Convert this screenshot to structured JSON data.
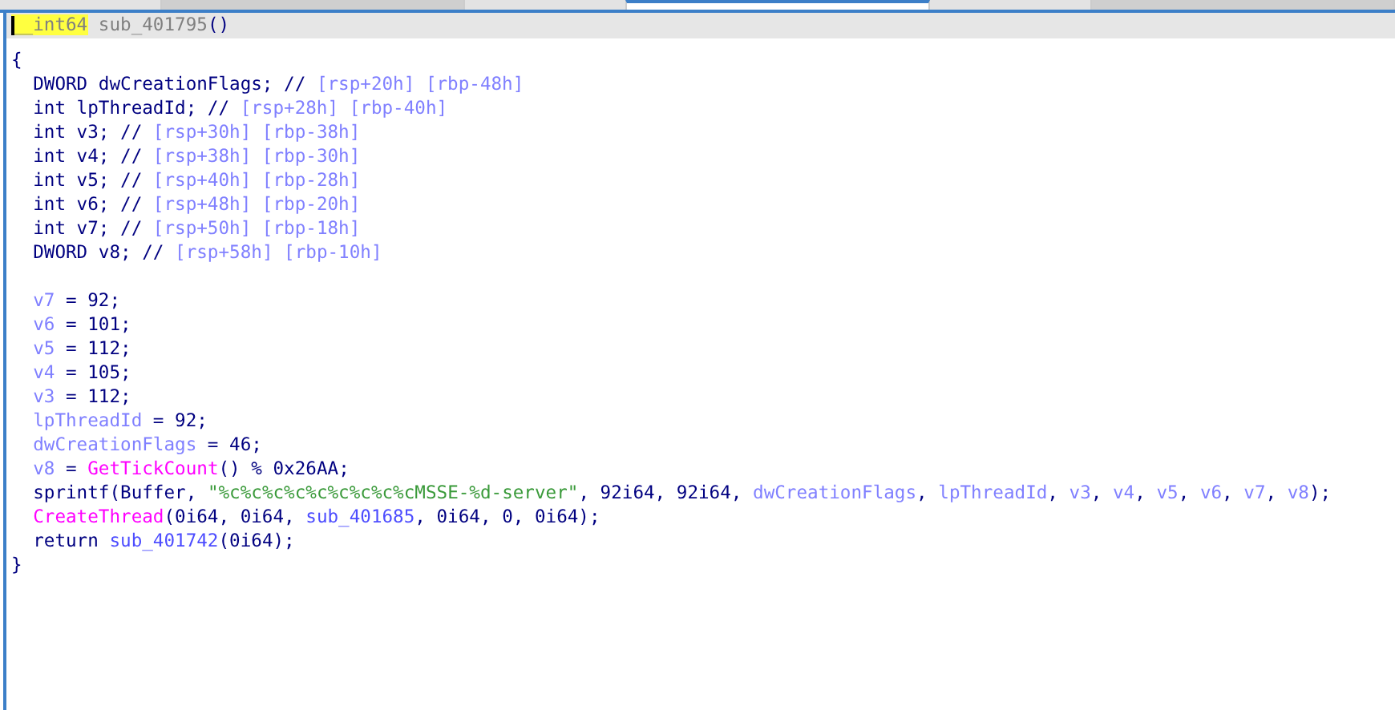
{
  "tabs": [
    {
      "selected": false
    },
    {
      "selected": true
    },
    {
      "selected": false
    }
  ],
  "lines": [
    {
      "current": true,
      "tokens": [
        {
          "text": "__int64",
          "kind": "hl"
        },
        {
          "text": " sub_401795",
          "kind": "name"
        },
        {
          "text": "()",
          "kind": "plain"
        }
      ]
    },
    {
      "current": false,
      "tokens": [
        {
          "text": "{",
          "kind": "plain"
        }
      ]
    },
    {
      "current": false,
      "tokens": [
        {
          "text": "  DWORD dwCreationFlags; // ",
          "kind": "plain"
        },
        {
          "text": "[rsp+20h] [rbp-48h]",
          "kind": "var"
        }
      ]
    },
    {
      "current": false,
      "tokens": [
        {
          "text": "  int lpThreadId; // ",
          "kind": "plain"
        },
        {
          "text": "[rsp+28h] [rbp-40h]",
          "kind": "var"
        }
      ]
    },
    {
      "current": false,
      "tokens": [
        {
          "text": "  int v3; // ",
          "kind": "plain"
        },
        {
          "text": "[rsp+30h] [rbp-38h]",
          "kind": "var"
        }
      ]
    },
    {
      "current": false,
      "tokens": [
        {
          "text": "  int v4; // ",
          "kind": "plain"
        },
        {
          "text": "[rsp+38h] [rbp-30h]",
          "kind": "var"
        }
      ]
    },
    {
      "current": false,
      "tokens": [
        {
          "text": "  int v5; // ",
          "kind": "plain"
        },
        {
          "text": "[rsp+40h] [rbp-28h]",
          "kind": "var"
        }
      ]
    },
    {
      "current": false,
      "tokens": [
        {
          "text": "  int v6; // ",
          "kind": "plain"
        },
        {
          "text": "[rsp+48h] [rbp-20h]",
          "kind": "var"
        }
      ]
    },
    {
      "current": false,
      "tokens": [
        {
          "text": "  int v7; // ",
          "kind": "plain"
        },
        {
          "text": "[rsp+50h] [rbp-18h]",
          "kind": "var"
        }
      ]
    },
    {
      "current": false,
      "tokens": [
        {
          "text": "  DWORD v8; // ",
          "kind": "plain"
        },
        {
          "text": "[rsp+58h] [rbp-10h]",
          "kind": "var"
        }
      ]
    },
    {
      "current": false,
      "gap_before": true,
      "tokens": [
        {
          "text": "  v7",
          "kind": "var"
        },
        {
          "text": " = 92;",
          "kind": "plain"
        }
      ]
    },
    {
      "current": false,
      "tokens": [
        {
          "text": "  v6",
          "kind": "var"
        },
        {
          "text": " = 101;",
          "kind": "plain"
        }
      ]
    },
    {
      "current": false,
      "tokens": [
        {
          "text": "  v5",
          "kind": "var"
        },
        {
          "text": " = 112;",
          "kind": "plain"
        }
      ]
    },
    {
      "current": false,
      "tokens": [
        {
          "text": "  v4",
          "kind": "var"
        },
        {
          "text": " = 105;",
          "kind": "plain"
        }
      ]
    },
    {
      "current": false,
      "tokens": [
        {
          "text": "  v3",
          "kind": "var"
        },
        {
          "text": " = 112;",
          "kind": "plain"
        }
      ]
    },
    {
      "current": false,
      "tokens": [
        {
          "text": "  lpThreadId",
          "kind": "var"
        },
        {
          "text": " = 92;",
          "kind": "plain"
        }
      ]
    },
    {
      "current": false,
      "tokens": [
        {
          "text": "  dwCreationFlags",
          "kind": "var"
        },
        {
          "text": " = 46;",
          "kind": "plain"
        }
      ]
    },
    {
      "current": false,
      "tokens": [
        {
          "text": "  v8",
          "kind": "var"
        },
        {
          "text": " = ",
          "kind": "plain"
        },
        {
          "text": "GetTickCount",
          "kind": "fn"
        },
        {
          "text": "() % 0x26AA;",
          "kind": "plain"
        }
      ]
    },
    {
      "current": false,
      "tokens": [
        {
          "text": "  sprintf(Buffer, ",
          "kind": "plain"
        },
        {
          "text": "\"%c%c%c%c%c%c%c%c%cMSSE-%d-server\"",
          "kind": "str"
        },
        {
          "text": ", 92i64, 92i64, ",
          "kind": "plain"
        },
        {
          "text": "dwCreationFlags",
          "kind": "var"
        },
        {
          "text": ", ",
          "kind": "plain"
        },
        {
          "text": "lpThreadId",
          "kind": "var"
        },
        {
          "text": ", ",
          "kind": "plain"
        },
        {
          "text": "v3",
          "kind": "var"
        },
        {
          "text": ", ",
          "kind": "plain"
        },
        {
          "text": "v4",
          "kind": "var"
        },
        {
          "text": ", ",
          "kind": "plain"
        },
        {
          "text": "v5",
          "kind": "var"
        },
        {
          "text": ", ",
          "kind": "plain"
        },
        {
          "text": "v6",
          "kind": "var"
        },
        {
          "text": ", ",
          "kind": "plain"
        },
        {
          "text": "v7",
          "kind": "var"
        },
        {
          "text": ", ",
          "kind": "plain"
        },
        {
          "text": "v8",
          "kind": "var"
        },
        {
          "text": ");",
          "kind": "plain"
        }
      ]
    },
    {
      "current": false,
      "tokens": [
        {
          "text": "  CreateThread",
          "kind": "fn"
        },
        {
          "text": "(0i64, 0i64, ",
          "kind": "plain"
        },
        {
          "text": "sub_401685",
          "kind": "sub"
        },
        {
          "text": ", 0i64, 0, 0i64);",
          "kind": "plain"
        }
      ]
    },
    {
      "current": false,
      "tokens": [
        {
          "text": "  return ",
          "kind": "plain"
        },
        {
          "text": "sub_401742",
          "kind": "sub"
        },
        {
          "text": "(0i64);",
          "kind": "plain"
        }
      ]
    },
    {
      "current": false,
      "tokens": [
        {
          "text": "}",
          "kind": "plain"
        }
      ]
    }
  ]
}
